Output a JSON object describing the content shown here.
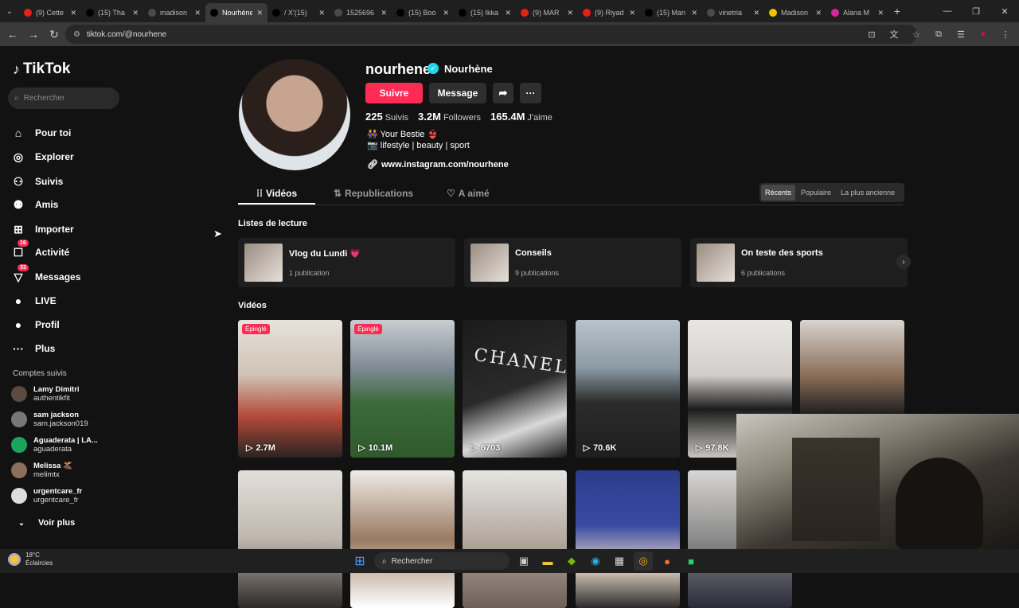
{
  "browser": {
    "tabs": [
      {
        "title": "(9) Cette",
        "fav": "#e62117",
        "active": false
      },
      {
        "title": "(15) Tha",
        "fav": "#000",
        "active": false
      },
      {
        "title": "madison",
        "fav": "#4a4a4a",
        "active": false
      },
      {
        "title": "Nourhène",
        "fav": "#000",
        "active": true
      },
      {
        "title": "/ X'(15)",
        "fav": "#000",
        "active": false
      },
      {
        "title": "1525696",
        "fav": "#4a4a4a",
        "active": false
      },
      {
        "title": "(15) Boo",
        "fav": "#000",
        "active": false
      },
      {
        "title": "(15) Ikka",
        "fav": "#000",
        "active": false
      },
      {
        "title": "(9) MAR",
        "fav": "#e62117",
        "active": false
      },
      {
        "title": "(9) Riyad",
        "fav": "#e62117",
        "active": false
      },
      {
        "title": "(15) Man",
        "fav": "#000",
        "active": false
      },
      {
        "title": "vinetria",
        "fav": "#4a4a4a",
        "active": false
      },
      {
        "title": "Madison",
        "fav": "#f2c200",
        "active": false
      },
      {
        "title": "Alana M",
        "fav": "#d6249f",
        "active": false
      }
    ],
    "url": "tiktok.com/@nourhene"
  },
  "sidebar": {
    "logo": "TikTok",
    "search_placeholder": "Rechercher",
    "items": [
      {
        "label": "Pour toi",
        "icon": "home-icon",
        "glyph": "⌂"
      },
      {
        "label": "Explorer",
        "icon": "compass-icon",
        "glyph": "◎"
      },
      {
        "label": "Suivis",
        "icon": "following-icon",
        "glyph": "⚇"
      },
      {
        "label": "Amis",
        "icon": "friends-icon",
        "glyph": "⚉"
      },
      {
        "label": "Importer",
        "icon": "upload-icon",
        "glyph": "⊞"
      },
      {
        "label": "Activité",
        "icon": "activity-icon",
        "glyph": "☐",
        "badge": "16"
      },
      {
        "label": "Messages",
        "icon": "messages-icon",
        "glyph": "▽",
        "badge": "33"
      },
      {
        "label": "LIVE",
        "icon": "live-icon",
        "glyph": "●"
      },
      {
        "label": "Profil",
        "icon": "profile-icon",
        "glyph": "●"
      },
      {
        "label": "Plus",
        "icon": "more-icon",
        "glyph": "···"
      }
    ],
    "following_title": "Comptes suivis",
    "following": [
      {
        "name": "Lamy Dimitri",
        "handle": "authentikfit"
      },
      {
        "name": "sam jackson",
        "handle": "sam.jackson019"
      },
      {
        "name": "Aguaderata | LA...",
        "handle": "aguaderata"
      },
      {
        "name": "Melissa 🫎",
        "handle": "melimtx"
      },
      {
        "name": "urgentcare_fr",
        "handle": "urgentcare_fr"
      }
    ],
    "see_more": "Voir plus"
  },
  "profile": {
    "username": "nourhene",
    "nickname": "Nourhène",
    "follow_label": "Suivre",
    "message_label": "Message",
    "following_count": "225",
    "following_label": "Suivis",
    "followers_count": "3.2M",
    "followers_label": "Followers",
    "likes_count": "165.4M",
    "likes_label": "J'aime",
    "bio_line1": "👭 Your Bestie 👙",
    "bio_line2": "📷 lifestyle | beauty | sport",
    "link": "www.instagram.com/nourhene"
  },
  "content_tabs": [
    {
      "label": "Vidéos",
      "icon": "grid-icon",
      "glyph": "⁞⁞",
      "active": true
    },
    {
      "label": "Republications",
      "icon": "repost-icon",
      "glyph": "⇅",
      "active": false
    },
    {
      "label": "A aimé",
      "icon": "heart-icon",
      "glyph": "♡",
      "active": false
    }
  ],
  "sort_options": [
    {
      "label": "Récents",
      "active": true
    },
    {
      "label": "Populaire",
      "active": false
    },
    {
      "label": "La plus ancienne",
      "active": false
    }
  ],
  "playlists_title": "Listes de lecture",
  "playlists": [
    {
      "name": "Vlog du Lundi 💗",
      "count": "1 publication"
    },
    {
      "name": "Conseils",
      "count": "9 publications"
    },
    {
      "name": "On teste des sports",
      "count": "6 publications"
    }
  ],
  "videos_title": "Vidéos",
  "pinned_label": "Épinglé",
  "videos": [
    {
      "views": "2.7M",
      "pinned": true,
      "bg": "linear-gradient(180deg,#e8e2dc 0,#cfc2b5 40%,#b44a3a 70%,#2b2420 100%)"
    },
    {
      "views": "10.1M",
      "pinned": true,
      "bg": "linear-gradient(180deg,#c9cdd2 0,#7f8a95 35%,#3d6b3a 60%,#2f5a2c 100%)"
    },
    {
      "views": "6703",
      "pinned": false,
      "bg": "linear-gradient(160deg,#1b1b1b 0,#2a2a2a 50%,#d9d9d9 75%,#1a1a1a 100%)"
    },
    {
      "views": "70.6K",
      "pinned": false,
      "bg": "linear-gradient(180deg,#b8c4cc 0,#8c9aa4 35%,#2b2b2b 60%,#1f1f1f 100%)"
    },
    {
      "views": "97.8K",
      "pinned": false,
      "bg": "linear-gradient(180deg,#e9e7e4 0,#d2cfcb 40%,#1c1c1c 65%,#c9c6c2 100%)"
    },
    {
      "views": "",
      "pinned": false,
      "bg": "linear-gradient(180deg,#d9d4ce 0,#8b6f5a 40%,#1a1a1a 70%,#101010 100%)"
    },
    {
      "views": "",
      "pinned": false,
      "bg": "linear-gradient(180deg,#e2dfdb 0,#bfb7ae 50%,#2c2a28 100%)"
    },
    {
      "views": "",
      "pinned": false,
      "bg": "linear-gradient(180deg,#efece8 0,#9a7b62 50%,#ffffff 100%)"
    },
    {
      "views": "",
      "pinned": false,
      "bg": "linear-gradient(180deg,#e6e4e2 0,#b4aaa0 50%,#6e5f55 100%)"
    },
    {
      "views": "",
      "pinned": false,
      "bg": "linear-gradient(180deg,#2c3c8c 0,#3a4aa0 40%,#e8d8c8 70%,#2a2a2a 100%)"
    },
    {
      "views": "",
      "pinned": false,
      "bg": "linear-gradient(180deg,#d8d6d4 0,#8a8a8a 50%,#2a2a3a 100%)"
    }
  ],
  "taskbar": {
    "temp": "18°C",
    "weather": "Éclaircies",
    "search_label": "Rechercher"
  },
  "colors": {
    "accent": "#fe2c55",
    "verified": "#20d5ec",
    "background": "#121212"
  }
}
